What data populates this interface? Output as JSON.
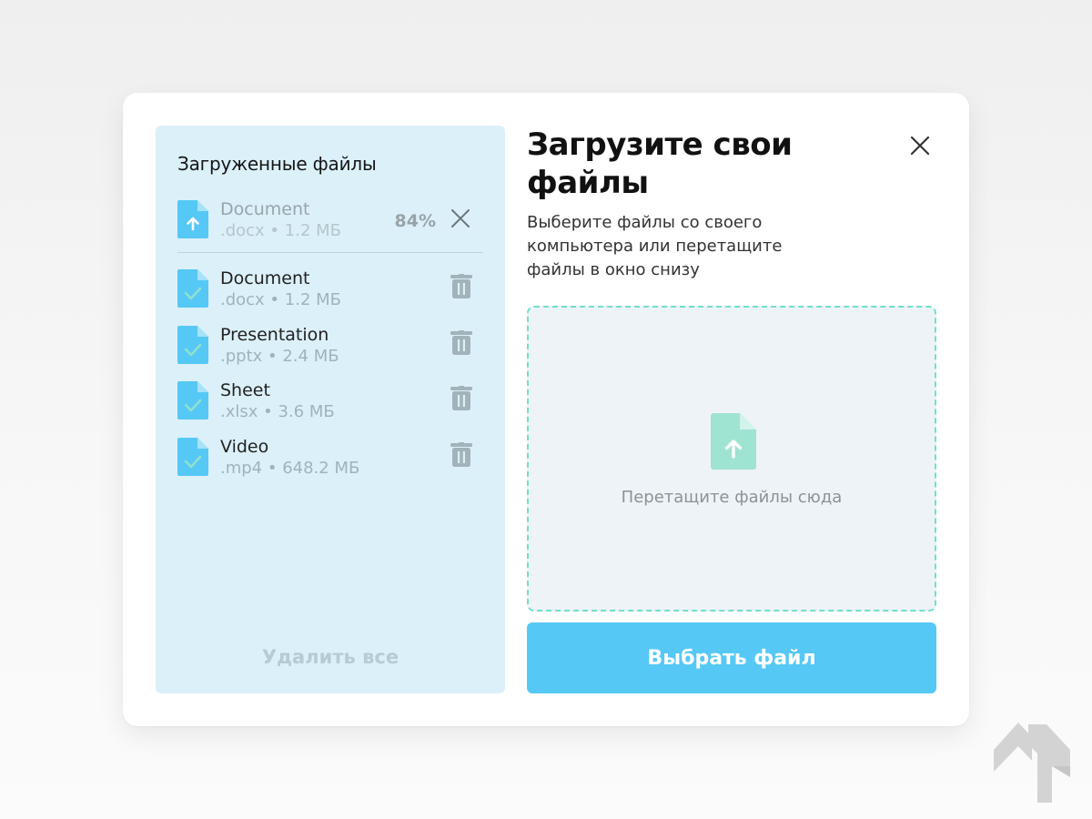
{
  "files_panel": {
    "title": "Загруженные файлы",
    "uploading": {
      "name": "Document",
      "meta": ".docx • 1.2 МБ",
      "progress_text": "84%",
      "progress_fraction": 0.84
    },
    "files": [
      {
        "name": "Document",
        "meta": ".docx • 1.2 МБ"
      },
      {
        "name": "Presentation",
        "meta": ".pptx • 2.4 МБ"
      },
      {
        "name": "Sheet",
        "meta": ".xlsx • 3.6 МБ"
      },
      {
        "name": "Video",
        "meta": ".mp4 • 648.2 МБ"
      }
    ],
    "delete_all_label": "Удалить все"
  },
  "upload": {
    "title": "Загрузите свои файлы",
    "subtitle": "Выберите файлы со своего компьютера или перетащите файлы в окно снизу",
    "dropzone_text": "Перетащите файлы сюда",
    "choose_button_label": "Выбрать файл"
  },
  "icons": {
    "close": "close-icon",
    "file_upload": "file-upload-icon",
    "file_done": "file-check-icon",
    "trash": "trash-icon",
    "cancel": "cancel-icon",
    "logo": "brand-logo"
  },
  "colors": {
    "panel_bg": "#dcf0f9",
    "file_icon": "#56c8f5",
    "accent_button": "#56c8f5",
    "dropzone_border": "#6fe0c9",
    "dropzone_icon": "#9fe3d2",
    "trash": "#a3b3ba"
  }
}
